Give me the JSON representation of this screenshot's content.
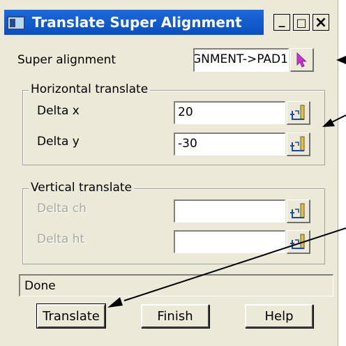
{
  "window": {
    "title": "Translate Super Alignment",
    "controls": {
      "minimize": "_",
      "maximize": "□",
      "close": "×"
    }
  },
  "super_alignment": {
    "label": "Super alignment",
    "value": "GNMENT->PAD1",
    "pick_icon": "cursor-arrow-icon"
  },
  "horizontal": {
    "title": "Horizontal translate",
    "delta_x": {
      "label": "Delta x",
      "value": "20"
    },
    "delta_y": {
      "label": "Delta y",
      "value": "-30"
    }
  },
  "vertical": {
    "title": "Vertical translate",
    "delta_ch": {
      "label": "Delta ch",
      "value": ""
    },
    "delta_ht": {
      "label": "Delta ht",
      "value": ""
    }
  },
  "status": "Done",
  "buttons": {
    "translate": "Translate",
    "finish": "Finish",
    "help": "Help"
  },
  "colors": {
    "title_bar": "#0b4fc0",
    "dialog_bg": "#ece9d8",
    "arrow": "#000000"
  }
}
